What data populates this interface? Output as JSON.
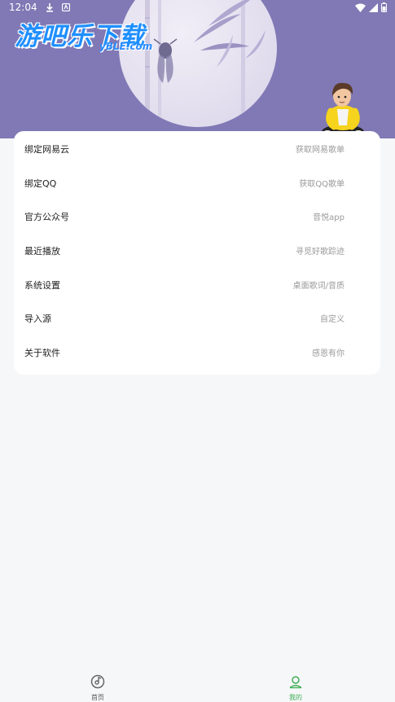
{
  "status_bar": {
    "time": "12:04",
    "icons": [
      "download-icon",
      "notification-icon",
      "wifi-icon",
      "signal-icon",
      "battery-icon"
    ]
  },
  "header": {
    "logo_text": "游吧乐下载",
    "logo_sub": "yBLE.com",
    "background_color": "#8079b5"
  },
  "menu": {
    "items": [
      {
        "label": "绑定网易云",
        "hint": "获取网易歌单"
      },
      {
        "label": "绑定QQ",
        "hint": "获取QQ歌单"
      },
      {
        "label": "官方公众号",
        "hint": "音悦app"
      },
      {
        "label": "最近播放",
        "hint": "寻觅好歌踪迹"
      },
      {
        "label": "系统设置",
        "hint": "桌面歌词/音质"
      },
      {
        "label": "导入源",
        "hint": "自定义"
      },
      {
        "label": "关于软件",
        "hint": "感恩有你"
      }
    ]
  },
  "bottom_nav": {
    "items": [
      {
        "label": "首页",
        "icon": "disc-icon",
        "active": false
      },
      {
        "label": "我的",
        "icon": "user-icon",
        "active": true
      }
    ],
    "active_color": "#3fae55",
    "inactive_color": "#555555"
  }
}
